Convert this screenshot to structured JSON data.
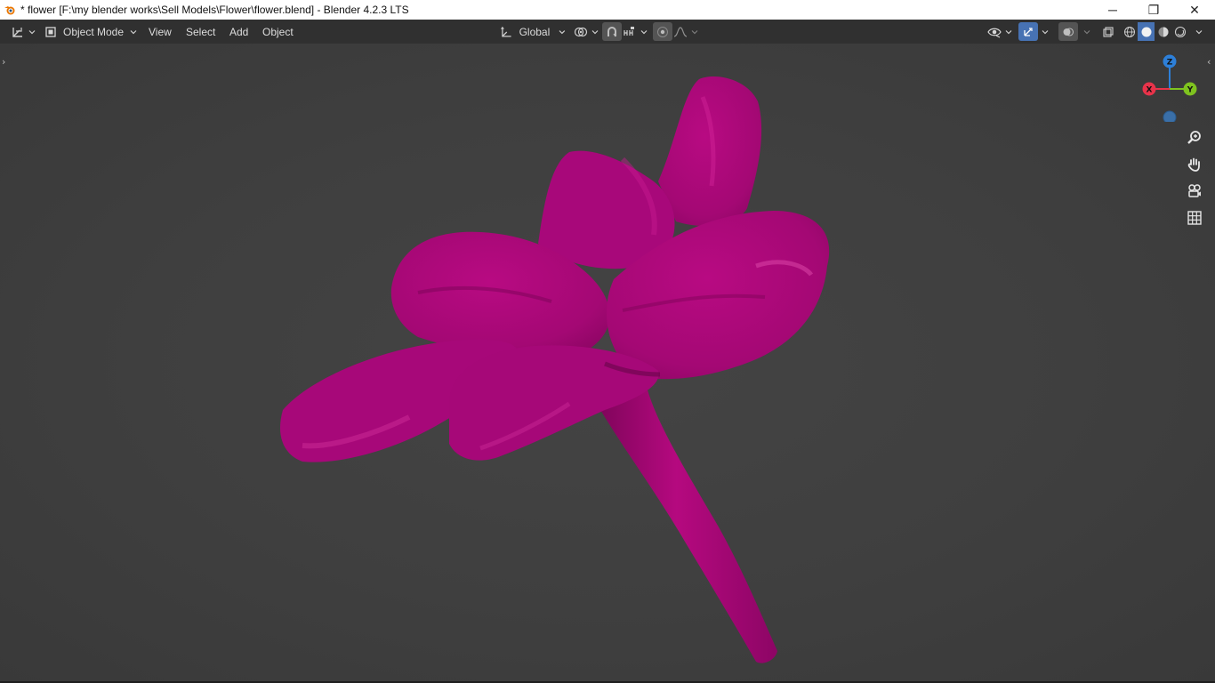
{
  "window": {
    "title": "* flower [F:\\my blender works\\Sell Models\\Flower\\flower.blend] - Blender 4.2.3 LTS",
    "controls": {
      "minimize": "─",
      "restore": "❐",
      "close": "✕"
    }
  },
  "header": {
    "editor_type_icon": "viewport-editor-icon",
    "mode": "Object Mode",
    "menus": [
      "View",
      "Select",
      "Add",
      "Object"
    ],
    "transform_orientation": "Global",
    "icons": {
      "pivot": "pivot-point-icon",
      "snap": "snap-magnet-icon",
      "snap_target": "snap-increment-icon",
      "proportional": "proportional-edit-icon",
      "falloff": "falloff-curve-icon",
      "visibility": "eye-visibility-icon",
      "gizmos": "gizmo-toggle-icon",
      "overlays": "overlays-icon",
      "xray": "xray-toggle-icon",
      "shading": [
        "wireframe-shading-icon",
        "solid-shading-icon",
        "material-shading-icon",
        "rendered-shading-icon"
      ]
    },
    "active_shading": "solid"
  },
  "viewport": {
    "object_color": "#b5097f",
    "background": "#3d3d3d",
    "gizmo": {
      "x_label": "X",
      "y_label": "Y",
      "z_label": "Z",
      "x_color": "#e8334a",
      "y_color": "#7fc31f",
      "z_color": "#2d7fd8"
    },
    "nav_tools": [
      "zoom-icon",
      "hand-pan-icon",
      "camera-view-icon",
      "grid-ortho-icon"
    ]
  }
}
